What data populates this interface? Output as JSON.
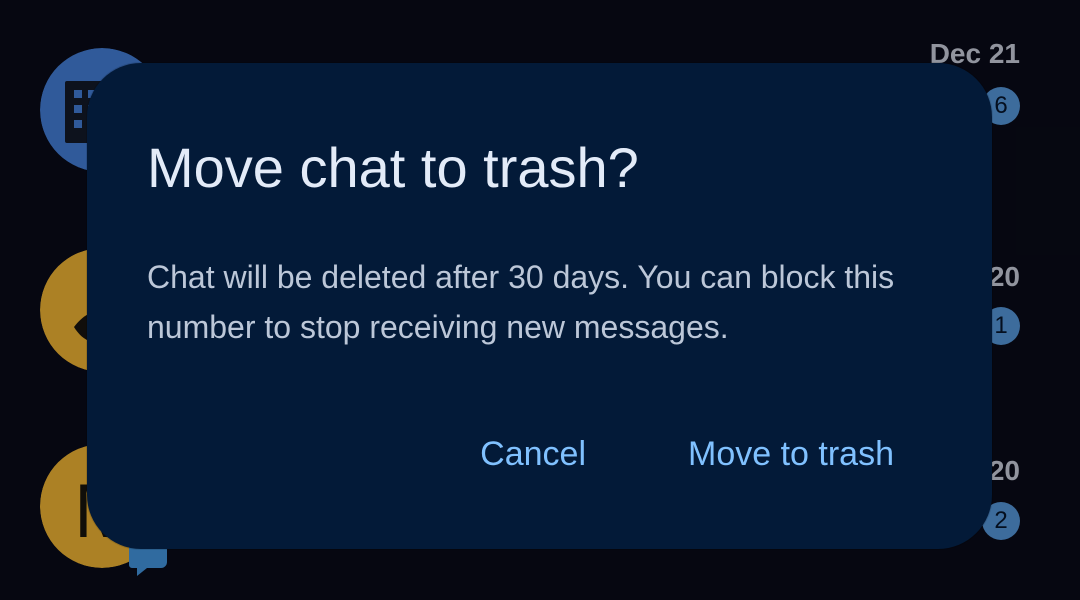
{
  "theme": {
    "background": "#070812",
    "dialog_background": "#031a38",
    "title_color": "#e3ebf8",
    "message_color": "#bcc7d8",
    "action_color": "#80c1ff",
    "badge_color": "#4e89c4"
  },
  "conversations": [
    {
      "avatar": {
        "type": "building-icon",
        "background": "#3d73c2"
      },
      "timestamp": "Dec 21",
      "unread_count": "6"
    },
    {
      "avatar": {
        "type": "contact-icon",
        "background": "#dba52c"
      },
      "timestamp": "20",
      "unread_count": "1"
    },
    {
      "avatar": {
        "type": "letter-icon",
        "background": "#dba52c",
        "letter": "M"
      },
      "timestamp": "20",
      "unread_count": "2"
    }
  ],
  "dialog": {
    "title": "Move chat to trash?",
    "message": "Chat will be deleted after 30 days. You can block this number to stop receiving new messages.",
    "cancel_label": "Cancel",
    "confirm_label": "Move to trash"
  }
}
